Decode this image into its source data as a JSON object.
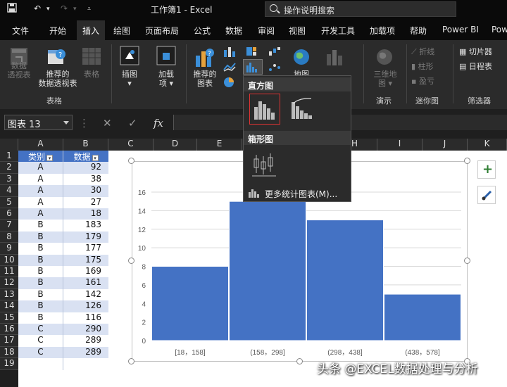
{
  "titlebar": {
    "filename": "工作簿1",
    "dash": "-",
    "app": "Excel",
    "search_placeholder": "操作说明搜索"
  },
  "tabs": [
    {
      "label": "文件"
    },
    {
      "label": "开始"
    },
    {
      "label": "插入",
      "active": true
    },
    {
      "label": "绘图"
    },
    {
      "label": "页面布局"
    },
    {
      "label": "公式"
    },
    {
      "label": "数据"
    },
    {
      "label": "审阅"
    },
    {
      "label": "视图"
    },
    {
      "label": "开发工具"
    },
    {
      "label": "加载项"
    },
    {
      "label": "帮助"
    },
    {
      "label": "Power BI"
    },
    {
      "label": "Pow"
    }
  ],
  "ribbon": {
    "pivot_line1": "数据",
    "pivot_line2": "透视表",
    "rec_pivot_line1": "推荐的",
    "rec_pivot_line2": "数据透视表",
    "table_label": "表格",
    "group_tables": "表格",
    "illustrations_label": "插图",
    "addins_label1": "加载",
    "addins_label2": "项",
    "rec_charts_line1": "推荐的",
    "rec_charts_line2": "图表",
    "map_label": "地图",
    "tour_line1": "三维地",
    "tour_line2": "图",
    "group_tour": "演示",
    "spark_line": "折线",
    "spark_column": "柱形",
    "spark_winloss": "盈亏",
    "group_sparklines": "迷你图",
    "slicer": "切片器",
    "timeline": "日程表",
    "group_filters": "筛选器"
  },
  "formula_bar": {
    "name_box": "图表 13",
    "cancel": "✕",
    "enter": "✓",
    "fx": "fx",
    "value": ""
  },
  "columns": [
    "A",
    "B",
    "C",
    "D",
    "E",
    "F",
    "G",
    "H",
    "I",
    "J",
    "K"
  ],
  "header_row": {
    "a": "类别",
    "b": "数据"
  },
  "rows": [
    {
      "n": "1"
    },
    {
      "n": "2",
      "a": "A",
      "b": "92"
    },
    {
      "n": "3",
      "a": "A",
      "b": "38"
    },
    {
      "n": "4",
      "a": "A",
      "b": "30"
    },
    {
      "n": "5",
      "a": "A",
      "b": "27"
    },
    {
      "n": "6",
      "a": "A",
      "b": "18"
    },
    {
      "n": "7",
      "a": "B",
      "b": "183"
    },
    {
      "n": "8",
      "a": "B",
      "b": "179"
    },
    {
      "n": "9",
      "a": "B",
      "b": "177"
    },
    {
      "n": "10",
      "a": "B",
      "b": "175"
    },
    {
      "n": "11",
      "a": "B",
      "b": "169"
    },
    {
      "n": "12",
      "a": "B",
      "b": "161"
    },
    {
      "n": "13",
      "a": "B",
      "b": "142"
    },
    {
      "n": "14",
      "a": "B",
      "b": "126"
    },
    {
      "n": "15",
      "a": "B",
      "b": "116"
    },
    {
      "n": "16",
      "a": "C",
      "b": "290"
    },
    {
      "n": "17",
      "a": "C",
      "b": "289"
    },
    {
      "n": "18",
      "a": "C",
      "b": "289"
    },
    {
      "n": "19",
      "a": "",
      "b": ""
    }
  ],
  "dropdown": {
    "histogram_header": "直方图",
    "box_header": "箱形图",
    "more_charts": "更多统计图表(M)..."
  },
  "chart_data": {
    "type": "bar",
    "title": "",
    "categories": [
      "[18，158]",
      "(158，298]",
      "(298，438]",
      "(438，578]"
    ],
    "values": [
      8,
      15,
      13,
      5
    ],
    "ylim": [
      0,
      16
    ],
    "yticks": [
      "0",
      "2",
      "4",
      "6",
      "8",
      "10",
      "12",
      "14",
      "16"
    ],
    "grid": true,
    "bar_color": "#4472c4"
  },
  "side_buttons": {
    "add": "+",
    "style": "brush"
  },
  "watermark": "头条 @EXCEL数据处理与分析"
}
